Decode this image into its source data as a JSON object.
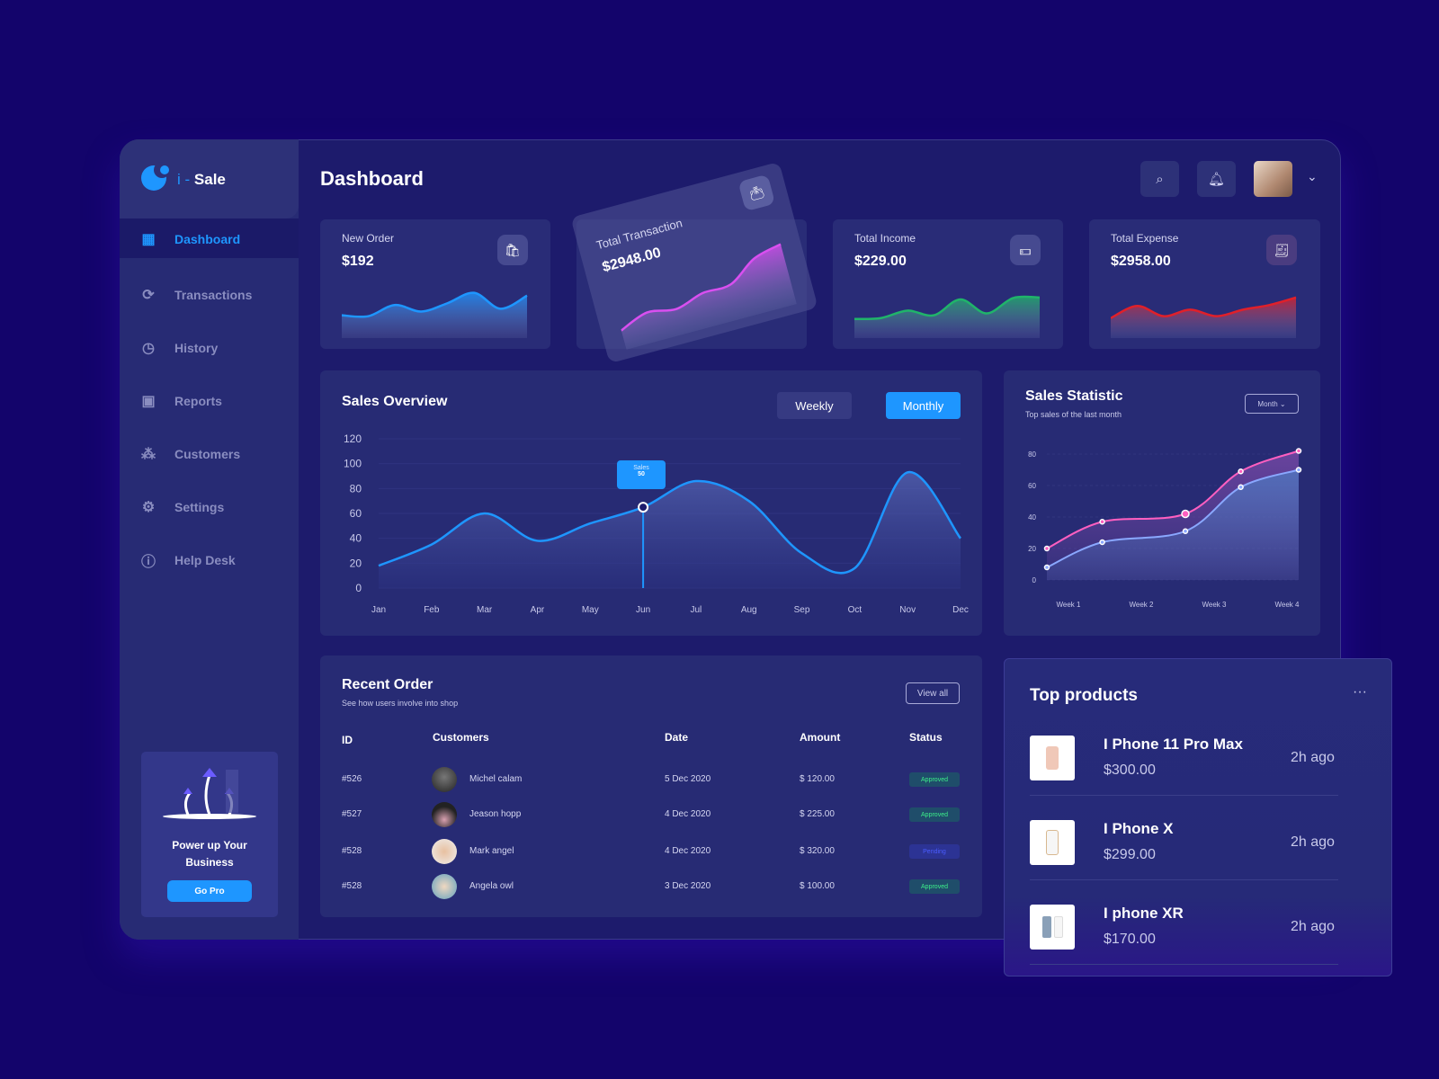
{
  "brand": {
    "prefix": "i -",
    "name": "Sale"
  },
  "sidebar": {
    "items": [
      {
        "label": "Dashboard",
        "icon": "dashboard-icon",
        "active": true
      },
      {
        "label": "Transactions",
        "icon": "dollar-cycle-icon"
      },
      {
        "label": "History",
        "icon": "history-icon"
      },
      {
        "label": "Reports",
        "icon": "boxes-icon"
      },
      {
        "label": "Customers",
        "icon": "people-icon"
      },
      {
        "label": "Settings",
        "icon": "gear-icon"
      },
      {
        "label": "Help Desk",
        "icon": "info-icon"
      }
    ],
    "promo": {
      "title": "Power up Your Business",
      "button": "Go Pro"
    }
  },
  "header": {
    "title": "Dashboard"
  },
  "cards": [
    {
      "title": "New Order",
      "value": "$192",
      "icon": "shopping-bag-icon",
      "color": "#1e96ff",
      "spark": [
        18,
        16,
        40,
        26,
        44,
        66,
        32,
        60
      ]
    },
    {
      "title": "Total Transaction",
      "value": "$2948.00",
      "icon": "wallet-icon",
      "color": "#d94ff0",
      "spark": [
        10,
        30,
        22,
        38,
        40,
        75,
        88
      ]
    },
    {
      "title": "Total Income",
      "value": "$229.00",
      "icon": "money-icon",
      "color": "#20b46a",
      "spark": [
        10,
        12,
        28,
        18,
        52,
        22,
        55,
        56
      ]
    },
    {
      "title": "Total Expense",
      "value": "$2958.00",
      "icon": "expense-icon",
      "color": "#e0202a",
      "spark": [
        12,
        38,
        16,
        30,
        16,
        30,
        40,
        56
      ]
    }
  ],
  "chart_data": [
    {
      "type": "area",
      "title": "Sales Overview",
      "categories": [
        "Jan",
        "Feb",
        "Mar",
        "Apr",
        "May",
        "Jun",
        "Jul",
        "Aug",
        "Sep",
        "Oct",
        "Nov",
        "Dec"
      ],
      "values": [
        18,
        35,
        60,
        38,
        52,
        65,
        86,
        70,
        28,
        16,
        93,
        40
      ],
      "ylim": [
        0,
        120
      ],
      "yticks": [
        0,
        20,
        40,
        60,
        80,
        100,
        120
      ],
      "tooltip": {
        "label": "Sales",
        "value": "50",
        "category": "Jun"
      },
      "color": "#1e96ff"
    },
    {
      "type": "line",
      "title": "Sales Statistic",
      "subtitle": "Top sales of the last month",
      "categories": [
        "Week 1",
        "Week 2",
        "Week 3",
        "Week 4"
      ],
      "ylim": [
        0,
        80
      ],
      "yticks": [
        0,
        20,
        40,
        60,
        80
      ],
      "series": [
        {
          "values": [
            20,
            37,
            42,
            69,
            82
          ],
          "color": "#ff5fc0"
        },
        {
          "values": [
            8,
            24,
            31,
            59,
            70
          ],
          "color": "#8aa8ff"
        }
      ]
    }
  ],
  "overview": {
    "weekly": "Weekly",
    "monthly": "Monthly"
  },
  "statistic": {
    "dropdown": "Month"
  },
  "orders": {
    "title": "Recent Order",
    "subtitle": "See how users involve into shop",
    "view_all": "View all",
    "columns": [
      "ID",
      "Customers",
      "Date",
      "Amount",
      "Status"
    ],
    "rows": [
      {
        "id": "#526",
        "customer": "Michel calam",
        "date": "5 Dec 2020",
        "amount": "$ 120.00",
        "status": "Approved"
      },
      {
        "id": "#527",
        "customer": "Jeason hopp",
        "date": "4 Dec 2020",
        "amount": "$ 225.00",
        "status": "Approved"
      },
      {
        "id": "#528",
        "customer": "Mark angel",
        "date": "4 Dec 2020",
        "amount": "$ 320.00",
        "status": "Pending"
      },
      {
        "id": "#528",
        "customer": "Angela owl",
        "date": "3 Dec 2020",
        "amount": "$ 100.00",
        "status": "Approved"
      }
    ]
  },
  "top_products": {
    "title": "Top products",
    "items": [
      {
        "name": "I Phone 11 Pro Max",
        "price": "$300.00",
        "time": "2h ago"
      },
      {
        "name": "I Phone X",
        "price": "$299.00",
        "time": "2h ago"
      },
      {
        "name": "I phone XR",
        "price": "$170.00",
        "time": "2h ago"
      }
    ]
  }
}
